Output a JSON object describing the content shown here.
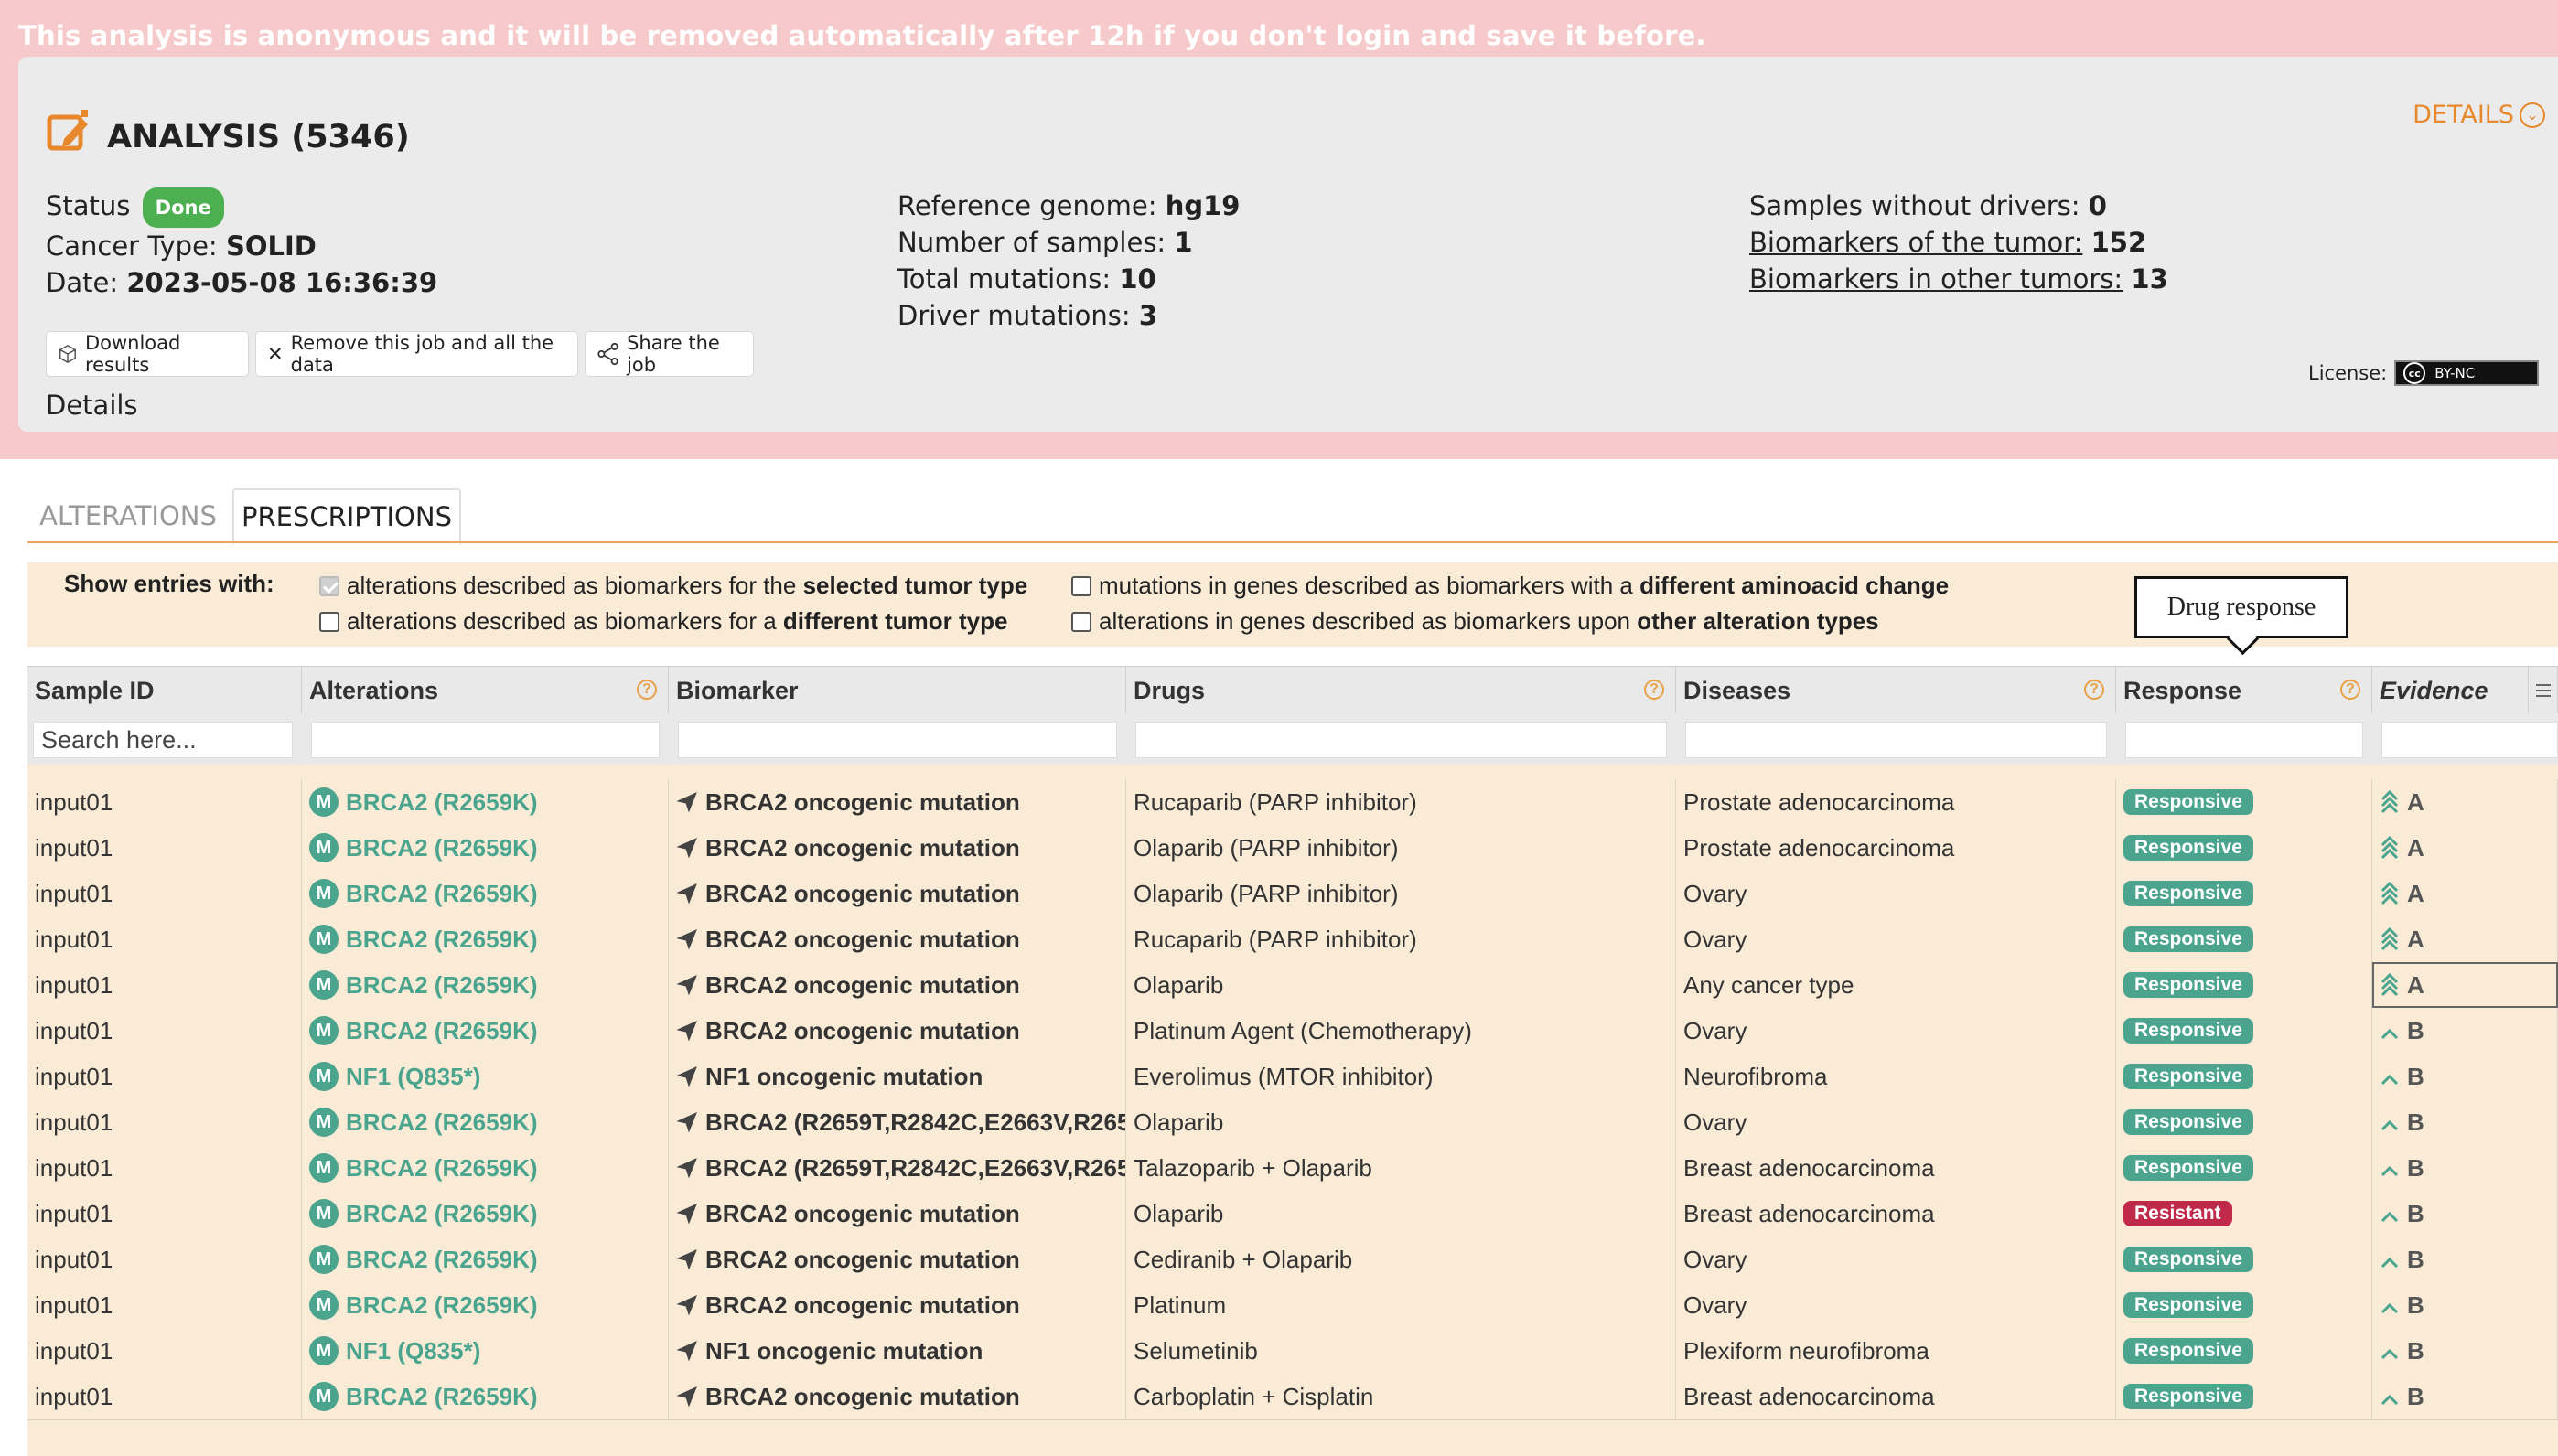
{
  "banner": {
    "message": "This analysis is anonymous and it will be removed automatically after 12h if you don't login and save it before."
  },
  "header": {
    "title": "ANALYSIS (5346)",
    "details_link": "DETAILS"
  },
  "info": {
    "status_label": "Status",
    "status_value": "Done",
    "cancer_type_label": "Cancer Type:",
    "cancer_type_value": "SOLID",
    "date_label": "Date:",
    "date_value": "2023-05-08 16:36:39",
    "ref_genome_label": "Reference genome:",
    "ref_genome_value": "hg19",
    "num_samples_label": "Number of samples:",
    "num_samples_value": "1",
    "total_mut_label": "Total mutations:",
    "total_mut_value": "10",
    "driver_mut_label": "Driver mutations:",
    "driver_mut_value": "3",
    "samples_wo_drivers_label": "Samples without drivers:",
    "samples_wo_drivers_value": "0",
    "biomarkers_tumor_label": "Biomarkers of the tumor:",
    "biomarkers_tumor_value": "152",
    "biomarkers_other_label": "Biomarkers in other tumors:",
    "biomarkers_other_value": "13"
  },
  "actions": {
    "download": "Download results",
    "remove": "Remove this job and all the data",
    "share": "Share the job",
    "details": "Details",
    "license_label": "License:",
    "license_badge": "BY-NC"
  },
  "tabs": {
    "alterations": "ALTERATIONS",
    "prescriptions": "PRESCRIPTIONS"
  },
  "filters": {
    "label": "Show entries with:",
    "opt1_pre": "alterations described as biomarkers for the ",
    "opt1_bold": "selected tumor type",
    "opt2_pre": "alterations described as biomarkers for a ",
    "opt2_bold": "different tumor type",
    "opt3_pre": "mutations in genes described as biomarkers with a ",
    "opt3_bold": "different aminoacid change",
    "opt4_pre": "alterations in genes described as biomarkers upon ",
    "opt4_bold": "other alteration types"
  },
  "tooltip": "Drug response",
  "table": {
    "headers": {
      "sample_id": "Sample ID",
      "alterations": "Alterations",
      "biomarker": "Biomarker",
      "drugs": "Drugs",
      "diseases": "Diseases",
      "response": "Response",
      "evidence": "Evidence"
    },
    "search_placeholder": "Search here...",
    "help_glyph": "?",
    "mutation_glyph": "M",
    "rows": [
      {
        "sample": "input01",
        "alteration": "BRCA2 (R2659K)",
        "biomarker": "BRCA2 oncogenic mutation",
        "drug": "Rucaparib (PARP inhibitor)",
        "disease": "Prostate adenocarcinoma",
        "response": "Responsive",
        "evidence": "A"
      },
      {
        "sample": "input01",
        "alteration": "BRCA2 (R2659K)",
        "biomarker": "BRCA2 oncogenic mutation",
        "drug": "Olaparib (PARP inhibitor)",
        "disease": "Prostate adenocarcinoma",
        "response": "Responsive",
        "evidence": "A"
      },
      {
        "sample": "input01",
        "alteration": "BRCA2 (R2659K)",
        "biomarker": "BRCA2 oncogenic mutation",
        "drug": "Olaparib (PARP inhibitor)",
        "disease": "Ovary",
        "response": "Responsive",
        "evidence": "A"
      },
      {
        "sample": "input01",
        "alteration": "BRCA2 (R2659K)",
        "biomarker": "BRCA2 oncogenic mutation",
        "drug": "Rucaparib (PARP inhibitor)",
        "disease": "Ovary",
        "response": "Responsive",
        "evidence": "A"
      },
      {
        "sample": "input01",
        "alteration": "BRCA2 (R2659K)",
        "biomarker": "BRCA2 oncogenic mutation",
        "drug": "Olaparib",
        "disease": "Any cancer type",
        "response": "Responsive",
        "evidence": "A"
      },
      {
        "sample": "input01",
        "alteration": "BRCA2 (R2659K)",
        "biomarker": "BRCA2 oncogenic mutation",
        "drug": "Platinum Agent (Chemotherapy)",
        "disease": "Ovary",
        "response": "Responsive",
        "evidence": "B"
      },
      {
        "sample": "input01",
        "alteration": "NF1 (Q835*)",
        "biomarker": "NF1 oncogenic mutation",
        "drug": "Everolimus (MTOR inhibitor)",
        "disease": "Neurofibroma",
        "response": "Responsive",
        "evidence": "B"
      },
      {
        "sample": "input01",
        "alteration": "BRCA2 (R2659K)",
        "biomarker": "BRCA2 (R2659T,R2842C,E2663V,R265",
        "drug": "Olaparib",
        "disease": "Ovary",
        "response": "Responsive",
        "evidence": "B"
      },
      {
        "sample": "input01",
        "alteration": "BRCA2 (R2659K)",
        "biomarker": "BRCA2 (R2659T,R2842C,E2663V,R265",
        "drug": "Talazoparib + Olaparib",
        "disease": "Breast adenocarcinoma",
        "response": "Responsive",
        "evidence": "B"
      },
      {
        "sample": "input01",
        "alteration": "BRCA2 (R2659K)",
        "biomarker": "BRCA2 oncogenic mutation",
        "drug": "Olaparib",
        "disease": "Breast adenocarcinoma",
        "response": "Resistant",
        "evidence": "B"
      },
      {
        "sample": "input01",
        "alteration": "BRCA2 (R2659K)",
        "biomarker": "BRCA2 oncogenic mutation",
        "drug": "Cediranib + Olaparib",
        "disease": "Ovary",
        "response": "Responsive",
        "evidence": "B"
      },
      {
        "sample": "input01",
        "alteration": "BRCA2 (R2659K)",
        "biomarker": "BRCA2 oncogenic mutation",
        "drug": "Platinum",
        "disease": "Ovary",
        "response": "Responsive",
        "evidence": "B"
      },
      {
        "sample": "input01",
        "alteration": "NF1 (Q835*)",
        "biomarker": "NF1 oncogenic mutation",
        "drug": "Selumetinib",
        "disease": "Plexiform neurofibroma",
        "response": "Responsive",
        "evidence": "B"
      },
      {
        "sample": "input01",
        "alteration": "BRCA2 (R2659K)",
        "biomarker": "BRCA2 oncogenic mutation",
        "drug": "Carboplatin + Cisplatin",
        "disease": "Breast adenocarcinoma",
        "response": "Responsive",
        "evidence": "B"
      }
    ]
  },
  "colors": {
    "accent": "#e8882c",
    "mutation_green": "#4ba58e",
    "responsive": "#4ba58e",
    "resistant": "#c0294a",
    "done": "#4caf50",
    "banner": "#f6caca",
    "table_bg": "#faebd7"
  },
  "icons": {
    "edit": "edit-square-icon",
    "chevron": "chevron-down-circle-icon",
    "package": "package-icon",
    "close": "close-icon",
    "share": "share-icon",
    "biomarker": "paper-plane-icon",
    "evidence_a": "double-chevron-up-icon",
    "evidence_b": "single-chevron-up-icon",
    "menu": "column-menu-icon"
  }
}
